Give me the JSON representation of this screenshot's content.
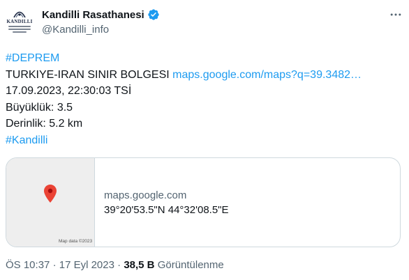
{
  "author": {
    "display_name": "Kandilli Rasathanesi",
    "handle": "@Kandilli_info",
    "avatar_text": "KANDILLI",
    "verified": true,
    "verified_color": "#1d9bf0"
  },
  "tweet": {
    "hashtag_1": "#DEPREM",
    "region": "TURKIYE-IRAN SINIR BOLGESI",
    "map_link": "maps.google.com/maps?q=39.3482…",
    "datetime": "17.09.2023, 22:30:03 TSİ",
    "magnitude": "Büyüklük: 3.5",
    "depth": "Derinlik: 5.2 km",
    "hashtag_2": "#Kandilli",
    "link_color": "#1d9bf0"
  },
  "card": {
    "domain": "maps.google.com",
    "title": "39°20'53.5\"N 44°32'08.5\"E",
    "map_credit": "Map data ©2023",
    "pin_color": "#ea4335"
  },
  "meta": {
    "time": "ÖS 10:37",
    "separator": "·",
    "date": "17 Eyl 2023",
    "views_count": "38,5 B",
    "views_label": "Görüntülenme"
  },
  "icons": {
    "more": "more-options-icon",
    "verified": "verified-badge-icon",
    "pin": "map-pin-icon"
  }
}
